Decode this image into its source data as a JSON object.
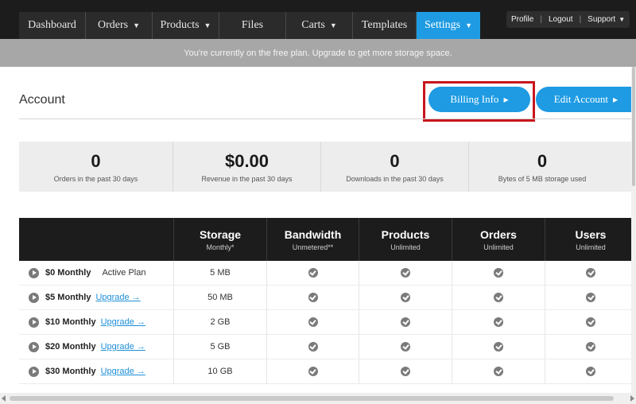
{
  "nav": {
    "items": [
      {
        "label": "Dashboard",
        "caret": false
      },
      {
        "label": "Orders",
        "caret": true
      },
      {
        "label": "Products",
        "caret": true
      },
      {
        "label": "Files",
        "caret": false
      },
      {
        "label": "Carts",
        "caret": true
      },
      {
        "label": "Templates",
        "caret": false
      },
      {
        "label": "Settings",
        "caret": true,
        "active": true
      }
    ],
    "util": {
      "profile": "Profile",
      "logout": "Logout",
      "support": "Support"
    }
  },
  "banner": {
    "text": "You're currently on the free plan. Upgrade to get more storage space."
  },
  "account": {
    "title": "Account",
    "billing_label": "Billing Info",
    "edit_label": "Edit Account"
  },
  "stats": [
    {
      "value": "0",
      "label": "Orders in the past 30 days"
    },
    {
      "value": "$0.00",
      "label": "Revenue in the past 30 days"
    },
    {
      "value": "0",
      "label": "Downloads in the past 30 days"
    },
    {
      "value": "0",
      "label": "Bytes of 5 MB storage used"
    }
  ],
  "plans": {
    "columns": [
      {
        "title": "",
        "sub": ""
      },
      {
        "title": "Storage",
        "sub": "Monthly*"
      },
      {
        "title": "Bandwidth",
        "sub": "Unmetered**"
      },
      {
        "title": "Products",
        "sub": "Unlimited"
      },
      {
        "title": "Orders",
        "sub": "Unlimited"
      },
      {
        "title": "Users",
        "sub": "Unlimited"
      }
    ],
    "rows": [
      {
        "name": "$0 Monthly",
        "status": "Active Plan",
        "link": "",
        "storage": "5 MB"
      },
      {
        "name": "$5 Monthly",
        "status": "",
        "link": "Upgrade →",
        "storage": "50 MB"
      },
      {
        "name": "$10 Monthly",
        "status": "",
        "link": "Upgrade →",
        "storage": "2 GB"
      },
      {
        "name": "$20 Monthly",
        "status": "",
        "link": "Upgrade →",
        "storage": "5 GB"
      },
      {
        "name": "$30 Monthly",
        "status": "",
        "link": "Upgrade →",
        "storage": "10 GB"
      }
    ]
  },
  "colors": {
    "accent": "#1e9be3",
    "highlight": "#c8161d",
    "topbar": "#1c1c1c",
    "banner": "#a7a7a7"
  }
}
